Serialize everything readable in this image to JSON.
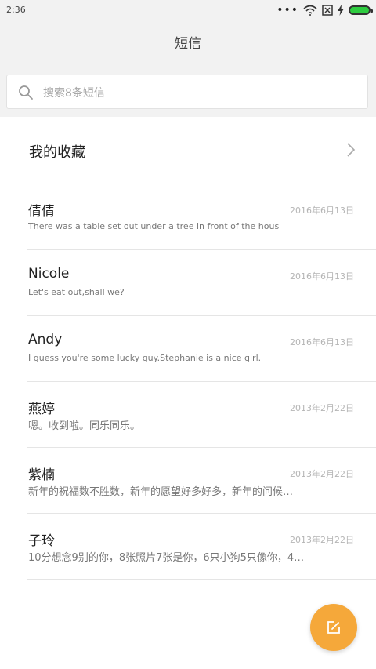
{
  "status_bar": {
    "time": "2:36",
    "icons": [
      "more-dots-icon",
      "wifi-icon",
      "no-sim-icon",
      "charging-icon",
      "battery-icon"
    ]
  },
  "header": {
    "title": "短信"
  },
  "search": {
    "placeholder": "搜索8条短信"
  },
  "favorites": {
    "label": "我的收藏"
  },
  "messages": [
    {
      "name": "倩倩",
      "date": "2016年6月13日",
      "preview": "There was a table set out under a tree in front of the hous"
    },
    {
      "name": "Nicole",
      "date": "2016年6月13日",
      "preview": "Let's eat out,shall we?"
    },
    {
      "name": "Andy",
      "date": "2016年6月13日",
      "preview": "I guess you're some lucky guy.Stephanie is a nice girl."
    },
    {
      "name": "燕婷",
      "date": "2013年2月22日",
      "preview": "嗯。收到啦。同乐同乐。"
    },
    {
      "name": "紫楠",
      "date": "2013年2月22日",
      "preview": "新年的祝福数不胜数，新年的愿望好多好多，新年的问候…"
    },
    {
      "name": "子玲",
      "date": "2013年2月22日",
      "preview": "10分想念9别的你，8张照片7张是你，6只小狗5只像你，4…"
    }
  ],
  "fab": {
    "icon": "compose-icon"
  },
  "colors": {
    "accent": "#f5a83a",
    "battery": "#2ecc40",
    "background": "#f2f2f2"
  }
}
